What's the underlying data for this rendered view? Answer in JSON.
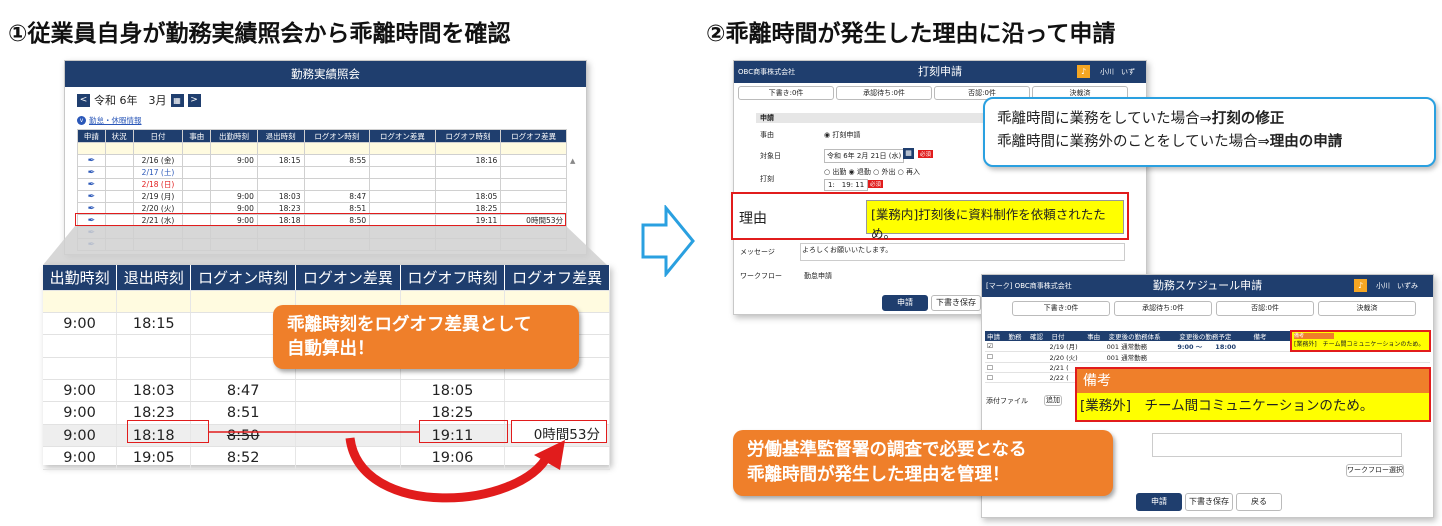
{
  "heading_left": "①従業員自身が勤務実績照会から乖離時間を確認",
  "heading_right": "②乖離時間が発生した理由に沿って申請",
  "colors": {
    "navy": "#1f3e6e",
    "orange": "#ef7f2a",
    "red": "#e11c1c",
    "yellow": "#ffff00",
    "blue_border": "#2aa0e0"
  },
  "attendance": {
    "title": "勤務実績照会",
    "period": "令和 6年　3月",
    "link": "勤怠・休暇情報",
    "columns": [
      "申請",
      "状況",
      "日付",
      "事由",
      "出勤時刻",
      "退出時刻",
      "ログオン時刻",
      "ログオン差異",
      "ログオフ時刻",
      "ログオフ差異"
    ],
    "rows": [
      {
        "date": "",
        "in": "",
        "out": "",
        "logon": "",
        "logon_diff": "",
        "logoff": "",
        "logoff_diff": ""
      },
      {
        "date": "2/16 (金)",
        "in": "9:00",
        "out": "18:15",
        "logon": "8:55",
        "logon_diff": "",
        "logoff": "18:16",
        "logoff_diff": ""
      },
      {
        "date": "2/17 (土)",
        "in": "",
        "out": "",
        "logon": "",
        "logon_diff": "",
        "logoff": "",
        "logoff_diff": ""
      },
      {
        "date": "2/18 (日)",
        "in": "",
        "out": "",
        "logon": "",
        "logon_diff": "",
        "logoff": "",
        "logoff_diff": ""
      },
      {
        "date": "2/19 (月)",
        "in": "9:00",
        "out": "18:03",
        "logon": "8:47",
        "logon_diff": "",
        "logoff": "18:05",
        "logoff_diff": ""
      },
      {
        "date": "2/20 (火)",
        "in": "9:00",
        "out": "18:23",
        "logon": "8:51",
        "logon_diff": "",
        "logoff": "18:25",
        "logoff_diff": ""
      },
      {
        "date": "2/21 (水)",
        "in": "9:00",
        "out": "18:18",
        "logon": "8:50",
        "logon_diff": "",
        "logoff": "19:11",
        "logoff_diff": "0時間53分"
      },
      {
        "date": "",
        "in": "",
        "out": "",
        "logon": "",
        "logon_diff": "",
        "logoff": "",
        "logoff_diff": ""
      },
      {
        "date": "",
        "in": "",
        "out": "",
        "logon": "",
        "logon_diff": "",
        "logoff": "",
        "logoff_diff": ""
      }
    ]
  },
  "zoom": {
    "columns": [
      "出勤時刻",
      "退出時刻",
      "ログオン時刻",
      "ログオン差異",
      "ログオフ時刻",
      "ログオフ差異"
    ],
    "rows": [
      [
        "",
        "",
        "",
        "",
        "",
        ""
      ],
      [
        "9:00",
        "18:15",
        "",
        "",
        "",
        ""
      ],
      [
        "",
        "",
        "",
        "",
        "",
        ""
      ],
      [
        "",
        "",
        "",
        "",
        "",
        ""
      ],
      [
        "9:00",
        "18:03",
        "8:47",
        "",
        "18:05",
        ""
      ],
      [
        "9:00",
        "18:23",
        "8:51",
        "",
        "18:25",
        ""
      ],
      [
        "9:00",
        "18:18",
        "8:50",
        "",
        "19:11",
        "0時間53分"
      ],
      [
        "9:00",
        "19:05",
        "8:52",
        "",
        "19:06",
        ""
      ]
    ]
  },
  "callout_auto": {
    "line1": "乖離時刻をログオフ差異として",
    "line2": "自動算出！"
  },
  "stamp_win": {
    "company": "OBC商事株式会社",
    "title": "打刻申請",
    "user": "小川　いず",
    "tabs": [
      "下書き:0件",
      "承認待ち:0件",
      "否認:0件",
      "決裁済"
    ],
    "section": "申請",
    "field_reason_label": "事由",
    "field_reason_value": "◉ 打刻申請",
    "field_date_label": "対象日",
    "field_date_value": "令和 6年 2月 21日 (水)",
    "required": "必須",
    "field_stamp_label": "打刻",
    "field_stamp_options": "○ 出勤 ◉ 退勤 ○ 外出 ○ 再入",
    "field_stamp_value": "1:　19: 11",
    "reason_label": "理由",
    "reason_value": "[業務内]打刻後に資料制作を依頼されたため。",
    "message_label": "メッセージ",
    "message_value": "よろしくお願いいたします。",
    "workflow_label": "ワークフロー",
    "workflow_value": "勤怠申請",
    "submit": "申請",
    "draft": "下書き保存"
  },
  "info_box": {
    "line1_prefix": "乖離時間に業務をしていた場合⇒",
    "line1_bold": "打刻の修正",
    "line2_prefix": "乖離時間に業務外のことをしていた場合⇒",
    "line2_bold": "理由の申請"
  },
  "schedule_win": {
    "company": "[マーク] OBC商事株式会社",
    "title": "勤務スケジュール申請",
    "user": "小川　いずみ",
    "tabs": [
      "下書き:0件",
      "承認待ち:0件",
      "否認:0件",
      "決裁済"
    ],
    "columns": [
      "申請",
      "勤務",
      "確認",
      "日付",
      "事由",
      "変更後の勤務体系",
      "変更後の勤務予定",
      "備考"
    ],
    "rows": [
      {
        "date": "2/19 (月)",
        "type": "001 通常勤務",
        "plan": "9:00 〜　　18:00",
        "note": "[業務外]　チーム間コミュニケーションのため。"
      },
      {
        "date": "2/20 (火)",
        "type": "001 通常勤務",
        "plan": "",
        "note": ""
      },
      {
        "date": "2/21 (",
        "type": "",
        "plan": "",
        "note": ""
      },
      {
        "date": "2/22 (",
        "type": "",
        "plan": "",
        "note": ""
      }
    ],
    "note_header": "備考",
    "note_value": "[業務外]　チーム間コミュニケーションのため。",
    "attach_label": "添付ファイル",
    "attach_add": "追加",
    "workflow_select": "ワークフロー選択",
    "submit": "申請",
    "draft": "下書き保存",
    "back": "戻る"
  },
  "callout_manage": {
    "line1": "労働基準監督署の調査で必要となる",
    "line2": "乖離時間が発生した理由を管理！"
  }
}
